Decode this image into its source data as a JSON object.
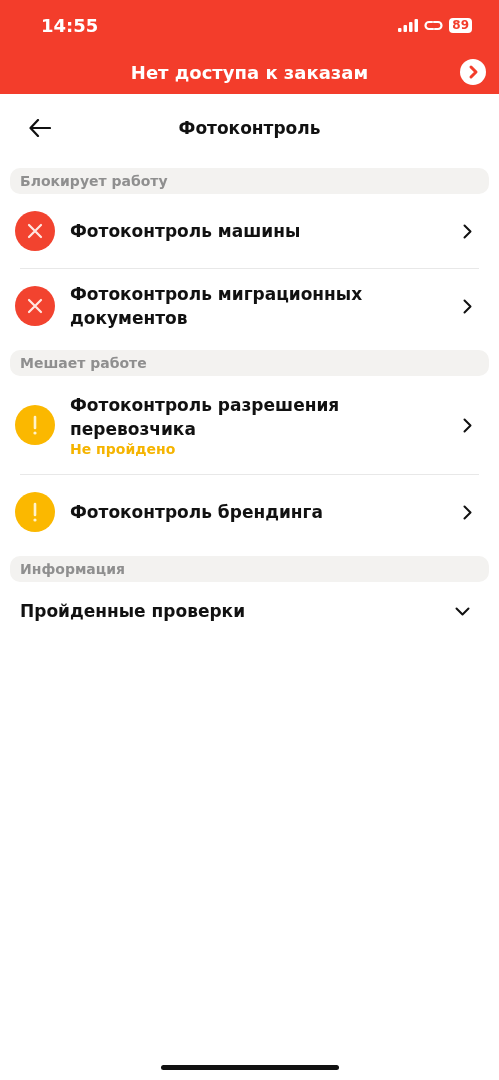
{
  "status_bar": {
    "time": "14:55",
    "battery": "89"
  },
  "banner": {
    "text": "Нет доступа к заказам"
  },
  "header": {
    "title": "Фотоконтроль"
  },
  "sections": [
    {
      "title": "Блокирует работу",
      "items": [
        {
          "kind": "error",
          "title": "Фотоконтроль машины"
        },
        {
          "kind": "error",
          "title": "Фотоконтроль миграционных документов"
        }
      ]
    },
    {
      "title": "Мешает работе",
      "items": [
        {
          "kind": "warning",
          "title": "Фотоконтроль разрешения перевозчика",
          "status": "Не пройдено"
        },
        {
          "kind": "warning",
          "title": "Фотоконтроль брендинга"
        }
      ]
    },
    {
      "title": "Информация",
      "collapsible": {
        "title": "Пройденные проверки",
        "expanded": false
      }
    }
  ]
}
